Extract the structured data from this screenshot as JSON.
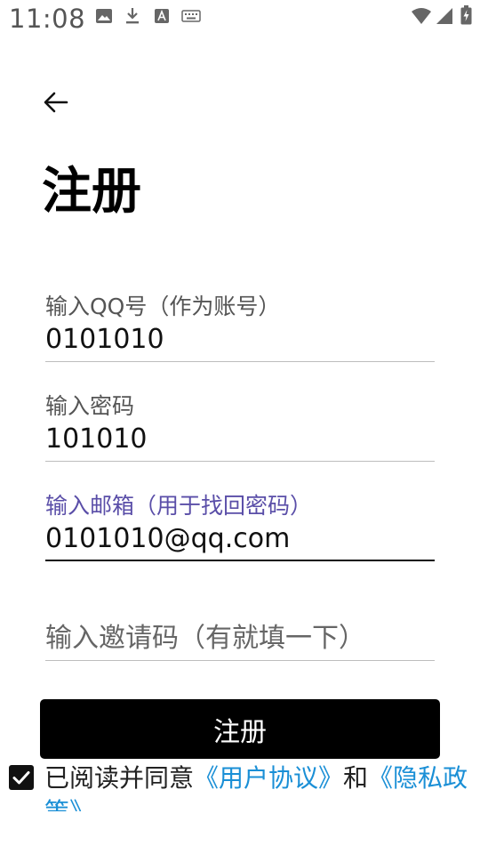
{
  "status_bar": {
    "time": "11:08"
  },
  "page": {
    "title": "注册"
  },
  "form": {
    "qq": {
      "label": "输入QQ号（作为账号）",
      "value": "0101010"
    },
    "password": {
      "label": "输入密码",
      "value": "101010"
    },
    "email": {
      "label": "输入邮箱（用于找回密码）",
      "value": "0101010@qq.com"
    },
    "invite": {
      "placeholder": "输入邀请码（有就填一下）",
      "value": ""
    }
  },
  "submit_label": "注册",
  "agreement": {
    "checked": true,
    "prefix": "已阅读并同意",
    "user_agreement": "《用户协议》",
    "conjunction": "和",
    "privacy_policy": "《隐私政策》"
  },
  "colors": {
    "accent_label": "#5a4ea8",
    "link": "#1a8fd6",
    "button_bg": "#000000"
  }
}
